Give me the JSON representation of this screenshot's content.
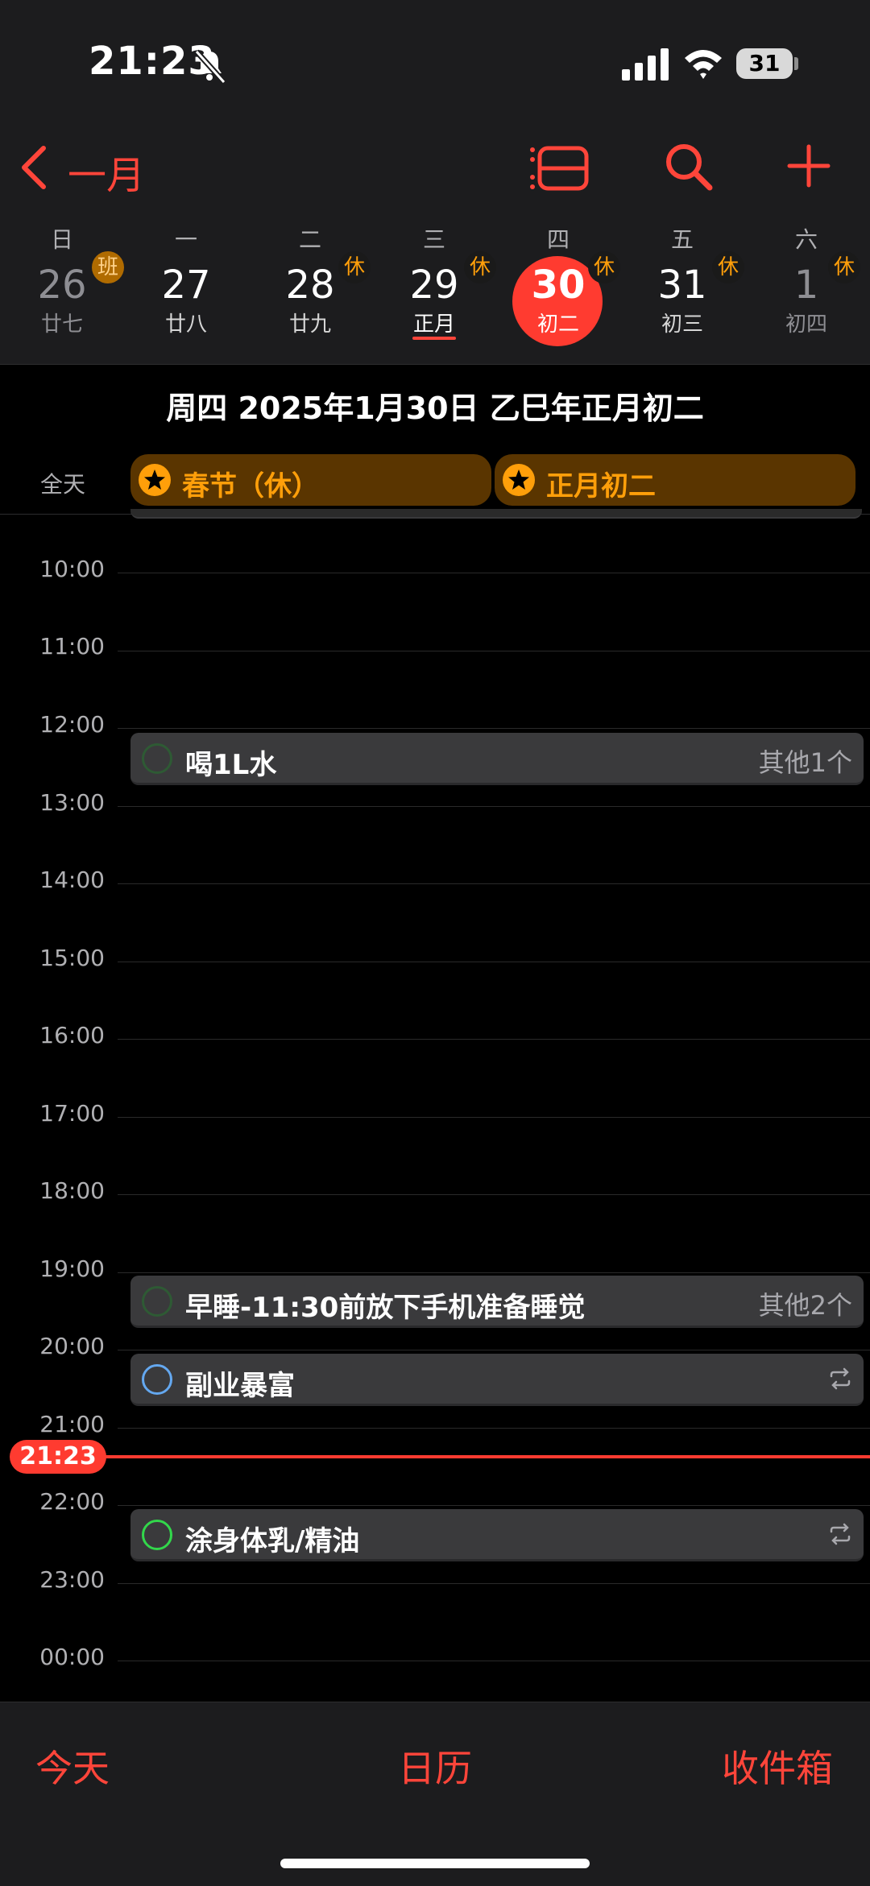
{
  "status_bar": {
    "time": "21:23",
    "battery": "31"
  },
  "nav": {
    "back_label": "一月"
  },
  "week": [
    {
      "dow": "日",
      "day": "26",
      "lunar": "廿七",
      "badge": "班",
      "dim": true
    },
    {
      "dow": "一",
      "day": "27",
      "lunar": "廿八",
      "badge": "",
      "dim": false
    },
    {
      "dow": "二",
      "day": "28",
      "lunar": "廿九",
      "badge": "休",
      "dim": false
    },
    {
      "dow": "三",
      "day": "29",
      "lunar": "正月",
      "badge": "休",
      "dim": false
    },
    {
      "dow": "四",
      "day": "30",
      "lunar": "初二",
      "badge": "休",
      "selected": true
    },
    {
      "dow": "五",
      "day": "31",
      "lunar": "初三",
      "badge": "休",
      "dim": false
    },
    {
      "dow": "六",
      "day": "1",
      "lunar": "初四",
      "badge": "休",
      "dim": true
    }
  ],
  "date_title": "周四 2025年1月30日  乙巳年正月初二",
  "all_day": {
    "label": "全天",
    "events": [
      "春节（休）",
      "正月初二"
    ]
  },
  "hours": [
    "10:00",
    "11:00",
    "12:00",
    "13:00",
    "14:00",
    "15:00",
    "16:00",
    "17:00",
    "18:00",
    "19:00",
    "20:00",
    "21:00",
    "22:00",
    "23:00",
    "00:00"
  ],
  "events": [
    {
      "title": "喝1L水",
      "more": "其他1个",
      "ring": "#2e5a34"
    },
    {
      "title": "早睡-11:30前放下手机准备睡觉",
      "more": "其他2个",
      "ring": "#2e5a34"
    },
    {
      "title": "副业暴富",
      "repeat": true,
      "ring": "#64a8f0"
    },
    {
      "title": "涂身体乳/精油",
      "repeat": true,
      "ring": "#32d74b"
    }
  ],
  "now_time": "21:23",
  "tabs": {
    "today": "今天",
    "calendar": "日历",
    "inbox": "收件箱"
  },
  "colors": {
    "accent": "#ff453a",
    "holiday": "#ff9f0a",
    "background": "#000000"
  }
}
